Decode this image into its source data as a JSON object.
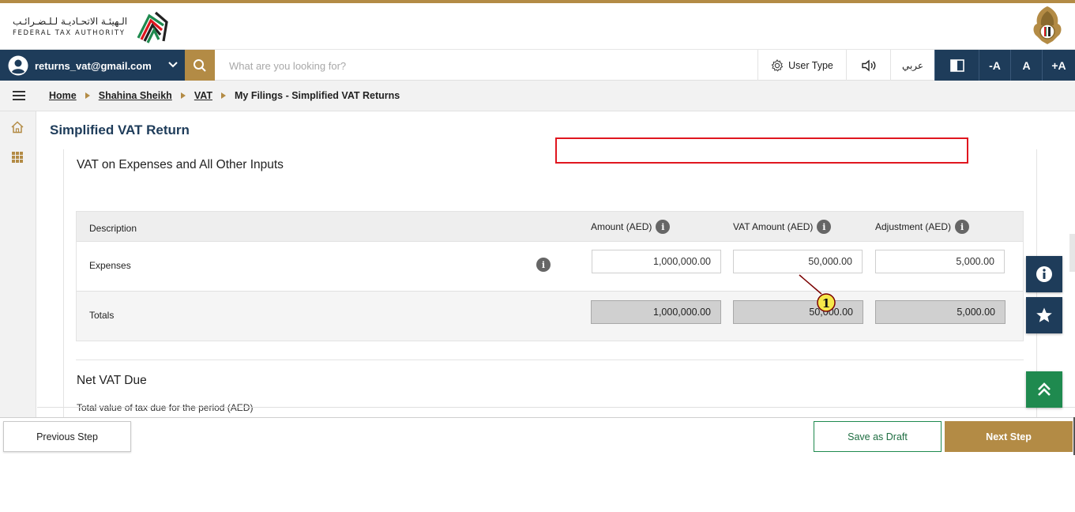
{
  "header": {
    "logo_arabic": "الـهيئـة الاتحـاديـة لـلـضـرائـب",
    "logo_english": "FEDERAL TAX AUTHORITY"
  },
  "nav": {
    "user_email": "returns_vat@gmail.com",
    "search_placeholder": "What are you looking for?",
    "user_type_label": "User Type",
    "arabic_label": "عربي",
    "font_decrease": "-A",
    "font_normal": "A",
    "font_increase": "+A"
  },
  "breadcrumb": {
    "items": [
      "Home",
      "Shahina Sheikh",
      "VAT"
    ],
    "current": "My Filings - Simplified VAT Returns"
  },
  "page": {
    "title": "Simplified VAT Return"
  },
  "section": {
    "title": "VAT on Expenses and All Other Inputs",
    "columns": {
      "description": "Description",
      "amount": "Amount (AED)",
      "vat_amount": "VAT Amount (AED)",
      "adjustment": "Adjustment (AED)"
    },
    "rows": [
      {
        "label": "Expenses",
        "amount": "1,000,000.00",
        "vat_amount": "50,000.00",
        "adjustment": "5,000.00"
      }
    ],
    "totals": {
      "label": "Totals",
      "amount": "1,000,000.00",
      "vat_amount": "50,000.00",
      "adjustment": "5,000.00"
    }
  },
  "net_vat": {
    "title": "Net VAT Due",
    "subtitle": "Total value of tax due for the period (AED)"
  },
  "callout": {
    "number": "1"
  },
  "footer": {
    "previous": "Previous Step",
    "save_draft": "Save as Draft",
    "next": "Next Step"
  },
  "colors": {
    "navy": "#1e3c5a",
    "gold": "#b38b45",
    "green": "#1f8a4f",
    "highlight": "#e0161f"
  },
  "icons": [
    "user-avatar-icon",
    "chevron-down-icon",
    "search-icon",
    "gear-icon",
    "speaker-icon",
    "contrast-icon",
    "hamburger-icon",
    "home-icon",
    "grid-icon",
    "info-icon",
    "star-icon",
    "double-chevron-up-icon"
  ]
}
